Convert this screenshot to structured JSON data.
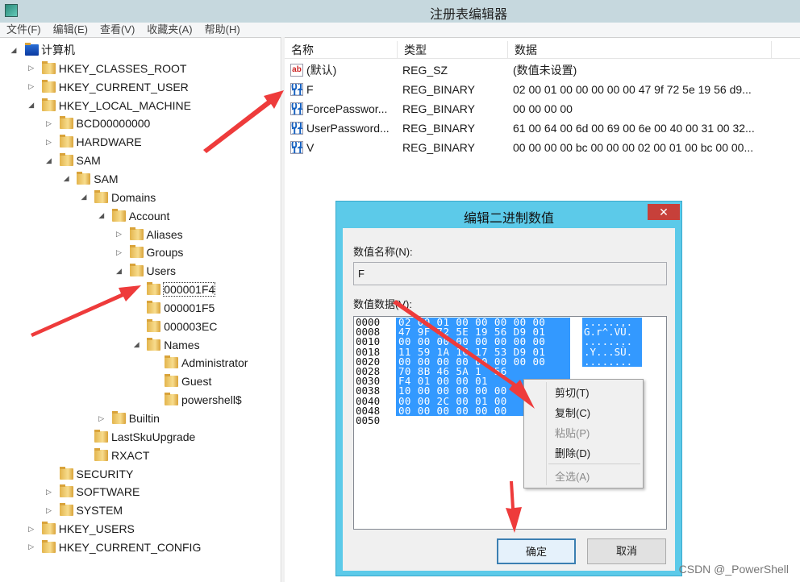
{
  "window": {
    "title": "注册表编辑器",
    "icon": "regedit-icon"
  },
  "menu": [
    "文件(F)",
    "编辑(E)",
    "查看(V)",
    "收藏夹(A)",
    "帮助(H)"
  ],
  "tree": [
    {
      "label": "计算机",
      "level": 0,
      "state": "expanded",
      "icon": "computer-icon"
    },
    {
      "label": "HKEY_CLASSES_ROOT",
      "level": 1,
      "state": "collapsed"
    },
    {
      "label": "HKEY_CURRENT_USER",
      "level": 1,
      "state": "collapsed"
    },
    {
      "label": "HKEY_LOCAL_MACHINE",
      "level": 1,
      "state": "expanded"
    },
    {
      "label": "BCD00000000",
      "level": 2,
      "state": "collapsed"
    },
    {
      "label": "HARDWARE",
      "level": 2,
      "state": "collapsed"
    },
    {
      "label": "SAM",
      "level": 2,
      "state": "expanded"
    },
    {
      "label": "SAM",
      "level": 3,
      "state": "expanded"
    },
    {
      "label": "Domains",
      "level": 4,
      "state": "expanded"
    },
    {
      "label": "Account",
      "level": 5,
      "state": "expanded"
    },
    {
      "label": "Aliases",
      "level": 6,
      "state": "collapsed"
    },
    {
      "label": "Groups",
      "level": 6,
      "state": "collapsed"
    },
    {
      "label": "Users",
      "level": 6,
      "state": "expanded"
    },
    {
      "label": "000001F4",
      "level": 7,
      "state": "leaf",
      "selected": true
    },
    {
      "label": "000001F5",
      "level": 7,
      "state": "leaf"
    },
    {
      "label": "000003EC",
      "level": 7,
      "state": "leaf"
    },
    {
      "label": "Names",
      "level": 7,
      "state": "expanded"
    },
    {
      "label": "Administrator",
      "level": 8,
      "state": "leaf"
    },
    {
      "label": "Guest",
      "level": 8,
      "state": "leaf"
    },
    {
      "label": "powershell$",
      "level": 8,
      "state": "leaf"
    },
    {
      "label": "Builtin",
      "level": 5,
      "state": "collapsed"
    },
    {
      "label": "LastSkuUpgrade",
      "level": 4,
      "state": "leaf"
    },
    {
      "label": "RXACT",
      "level": 4,
      "state": "leaf"
    },
    {
      "label": "SECURITY",
      "level": 2,
      "state": "leaf"
    },
    {
      "label": "SOFTWARE",
      "level": 2,
      "state": "collapsed"
    },
    {
      "label": "SYSTEM",
      "level": 2,
      "state": "collapsed"
    },
    {
      "label": "HKEY_USERS",
      "level": 1,
      "state": "collapsed"
    },
    {
      "label": "HKEY_CURRENT_CONFIG",
      "level": 1,
      "state": "collapsed"
    }
  ],
  "list": {
    "columns": [
      "名称",
      "类型",
      "数据"
    ],
    "rows": [
      {
        "name": "(默认)",
        "type": "REG_SZ",
        "data": "(数值未设置)",
        "icon": "string-value-icon"
      },
      {
        "name": "F",
        "type": "REG_BINARY",
        "data": "02 00 01 00 00 00 00 00 47 9f 72 5e 19 56 d9...",
        "icon": "binary-value-icon"
      },
      {
        "name": "ForcePasswor...",
        "type": "REG_BINARY",
        "data": "00 00 00 00",
        "icon": "binary-value-icon"
      },
      {
        "name": "UserPassword...",
        "type": "REG_BINARY",
        "data": "61 00 64 00 6d 00 69 00 6e 00 40 00 31 00 32...",
        "icon": "binary-value-icon"
      },
      {
        "name": "V",
        "type": "REG_BINARY",
        "data": "00 00 00 00 bc 00 00 00 02 00 01 00 bc 00 00...",
        "icon": "binary-value-icon"
      }
    ]
  },
  "dialog": {
    "title": "编辑二进制数值",
    "close": "✕",
    "name_label": "数值名称(N):",
    "name_value": "F",
    "data_label": "数值数据(V):",
    "hex": [
      {
        "offset": "0000",
        "bytes": "02 00 01 00 00 00 00 00",
        "ascii": "........"
      },
      {
        "offset": "0008",
        "bytes": "47 9F 72 5E 19 56 D9 01",
        "ascii": "G.r^.VÙ."
      },
      {
        "offset": "0010",
        "bytes": "00 00 00 00 00 00 00 00",
        "ascii": "........"
      },
      {
        "offset": "0018",
        "bytes": "11 59 1A 1C 17 53 D9 01",
        "ascii": ".Y...SÙ."
      },
      {
        "offset": "0020",
        "bytes": "00 00 00 00 00 00 00 00",
        "ascii": "........"
      },
      {
        "offset": "0028",
        "bytes": "70 8B 46 5A 1  56",
        "ascii": ""
      },
      {
        "offset": "0030",
        "bytes": "F4 01 00 00 01",
        "ascii": ""
      },
      {
        "offset": "0038",
        "bytes": "10 00 00 00 00 00",
        "ascii": ""
      },
      {
        "offset": "0040",
        "bytes": "00 00 2C 00 01 00",
        "ascii": ""
      },
      {
        "offset": "0048",
        "bytes": "00 00 00 00 00 00",
        "ascii": ""
      },
      {
        "offset": "0050",
        "bytes": "",
        "ascii": ""
      }
    ],
    "ok": "确定",
    "cancel": "取消"
  },
  "context_menu": [
    {
      "label": "剪切(T)",
      "enabled": true
    },
    {
      "label": "复制(C)",
      "enabled": true
    },
    {
      "label": "粘贴(P)",
      "enabled": false
    },
    {
      "label": "删除(D)",
      "enabled": true
    },
    {
      "label": "全选(A)",
      "enabled": false
    }
  ],
  "watermark": "CSDN @_PowerShell",
  "colors": {
    "selection": "#3399ff",
    "dialog_title": "#5ccae9",
    "close": "#c7403a",
    "arrow": "#ee3b3b"
  }
}
